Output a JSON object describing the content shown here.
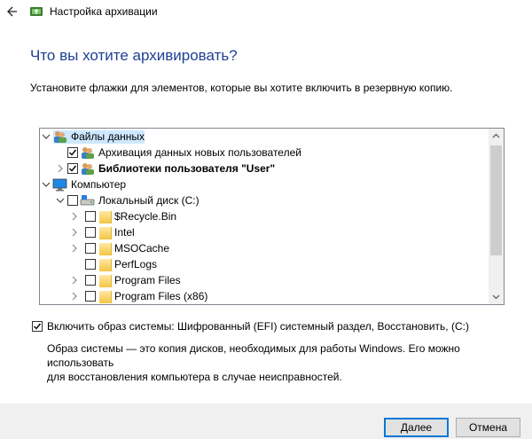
{
  "window": {
    "title": "Настройка архивации"
  },
  "page": {
    "heading": "Что вы хотите архивировать?",
    "instruction": "Установите флажки для элементов, которые вы хотите включить в резервную копию."
  },
  "tree": {
    "items": [
      {
        "label": "Файлы данных"
      },
      {
        "label": "Архивация данных новых пользователей",
        "checked": true
      },
      {
        "label": "Библиотеки пользователя \"User\"",
        "checked": true
      },
      {
        "label": "Компьютер"
      },
      {
        "label": "Локальный диск (C:)",
        "checked": false
      },
      {
        "label": "$Recycle.Bin",
        "checked": false
      },
      {
        "label": "Intel",
        "checked": false
      },
      {
        "label": "MSOCache",
        "checked": false
      },
      {
        "label": "PerfLogs",
        "checked": false
      },
      {
        "label": "Program Files",
        "checked": false
      },
      {
        "label": "Program Files (x86)",
        "checked": false
      }
    ]
  },
  "system_image": {
    "label": "Включить образ системы: Шифрованный (EFI) системный раздел, Восстановить, (C:)",
    "checked": true,
    "description": "Образ системы — это копия дисков, необходимых для работы Windows. Его можно использовать\nдля восстановления компьютера в случае неисправностей."
  },
  "buttons": {
    "next": "Далее",
    "cancel": "Отмена"
  }
}
